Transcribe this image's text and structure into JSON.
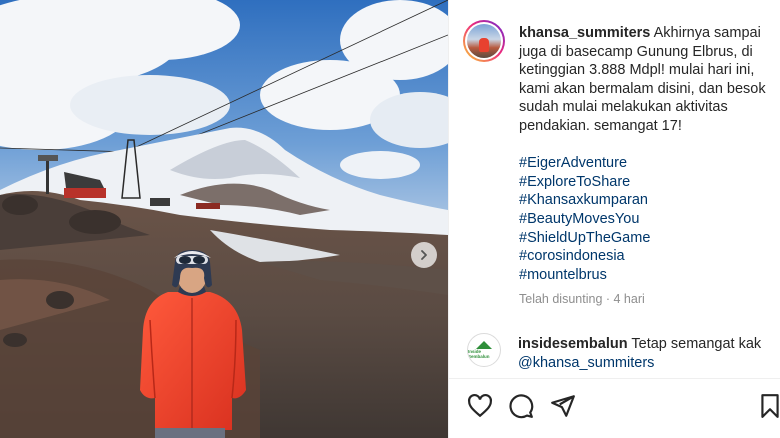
{
  "post": {
    "username": "khansa_summiters",
    "caption": "Akhirnya sampai juga di basecamp Gunung Elbrus, di ketinggian 3.888 Mdpl! mulai hari ini, kami akan bermalam disini, dan besok sudah mulai melakukan aktivitas pendakian. semangat 17!",
    "hashtags": [
      "#EigerAdventure",
      "#ExploreToShare",
      "#Khansaxkumparan",
      "#BeautyMovesYou",
      "#ShieldUpTheGame",
      "#corosindonesia",
      "#mountelbrus"
    ],
    "timestamp": "Telah disunting · 4 hari"
  },
  "comment": {
    "username": "insidesembalun",
    "text": "Tetap semangat kak",
    "mention": "@khansa_summiters",
    "avatar_text": "Inside Sembalun"
  },
  "icons": {
    "next": "chevron-right-icon",
    "like": "heart-icon",
    "comment": "comment-icon",
    "share": "send-icon",
    "save": "bookmark-icon",
    "comment_like": "heart-icon"
  },
  "colors": {
    "text": "#262626",
    "link": "#00376b",
    "muted": "#8e8e8e",
    "jacket": "#e8412f"
  }
}
